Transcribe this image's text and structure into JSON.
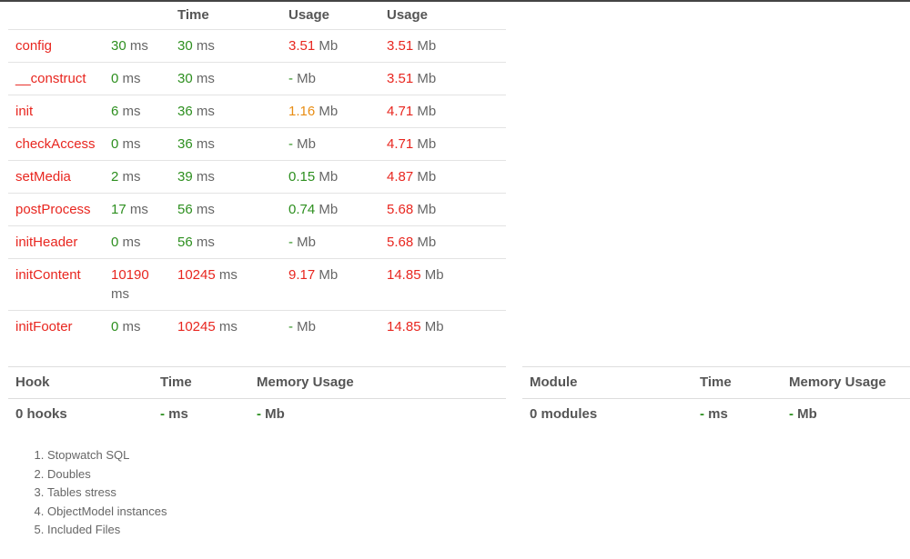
{
  "main_table": {
    "headers": [
      "",
      "",
      "Time",
      "Usage",
      "Usage"
    ],
    "rows": [
      {
        "name": "config",
        "time": "30",
        "total": "30",
        "mem": "3.51",
        "memtotal": "3.51",
        "c1": "g",
        "c2": "g",
        "c3": "r",
        "c4": "r"
      },
      {
        "name": "__construct",
        "time": "0",
        "total": "30",
        "mem": "-",
        "memtotal": "3.51",
        "c1": "g",
        "c2": "g",
        "c3": "g",
        "c4": "r"
      },
      {
        "name": "init",
        "time": "6",
        "total": "36",
        "mem": "1.16",
        "memtotal": "4.71",
        "c1": "g",
        "c2": "g",
        "c3": "o",
        "c4": "r"
      },
      {
        "name": "checkAccess",
        "time": "0",
        "total": "36",
        "mem": "-",
        "memtotal": "4.71",
        "c1": "g",
        "c2": "g",
        "c3": "g",
        "c4": "r"
      },
      {
        "name": "setMedia",
        "time": "2",
        "total": "39",
        "mem": "0.15",
        "memtotal": "4.87",
        "c1": "g",
        "c2": "g",
        "c3": "g",
        "c4": "r"
      },
      {
        "name": "postProcess",
        "time": "17",
        "total": "56",
        "mem": "0.74",
        "memtotal": "5.68",
        "c1": "g",
        "c2": "g",
        "c3": "g",
        "c4": "r"
      },
      {
        "name": "initHeader",
        "time": "0",
        "total": "56",
        "mem": "-",
        "memtotal": "5.68",
        "c1": "g",
        "c2": "g",
        "c3": "g",
        "c4": "r"
      },
      {
        "name": "initContent",
        "time": "10190",
        "total": "10245",
        "mem": "9.17",
        "memtotal": "14.85",
        "c1": "r",
        "c2": "r",
        "c3": "r",
        "c4": "r"
      },
      {
        "name": "initFooter",
        "time": "0",
        "total": "10245",
        "mem": "-",
        "memtotal": "14.85",
        "c1": "g",
        "c2": "r",
        "c3": "g",
        "c4": "r"
      }
    ],
    "unit_ms": "ms",
    "unit_mb": "Mb"
  },
  "hooks": {
    "headers": [
      "Hook",
      "Time",
      "Memory Usage"
    ],
    "row": {
      "name": "0 hooks",
      "time": "-",
      "time_unit": "ms",
      "mem": "-",
      "mem_unit": "Mb"
    }
  },
  "modules": {
    "headers": [
      "Module",
      "Time",
      "Memory Usage"
    ],
    "row": {
      "name": "0 modules",
      "time": "-",
      "time_unit": "ms",
      "mem": "-",
      "mem_unit": "Mb"
    }
  },
  "links": [
    "Stopwatch SQL",
    "Doubles",
    "Tables stress",
    "ObjectModel instances",
    "Included Files"
  ],
  "colors": {
    "green": "#2d8f1f",
    "red": "#e8261f",
    "orange": "#e88d14"
  }
}
